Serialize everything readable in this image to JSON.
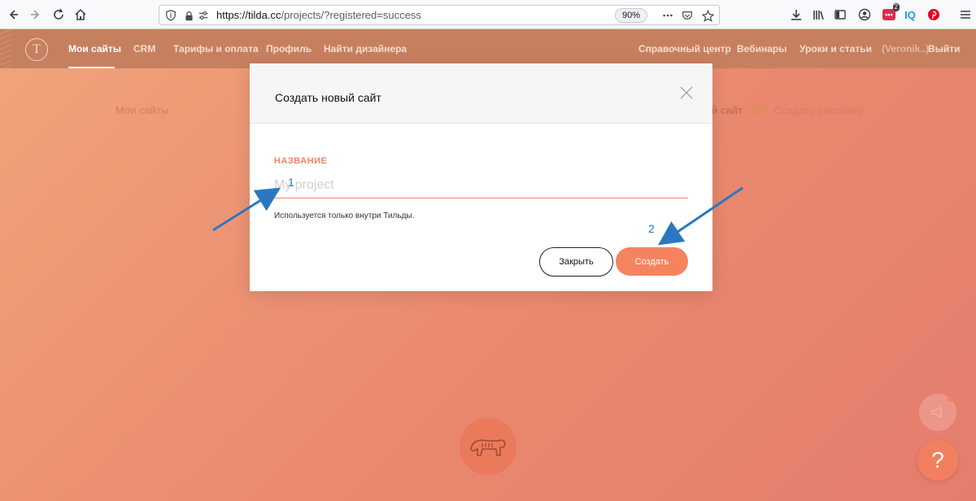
{
  "browser": {
    "url_host": "https://tilda.cc",
    "url_path": "/projects/?registered=success",
    "zoom": "90%",
    "extension_badge_count": "2",
    "extension_iq_label": "IQ"
  },
  "nav": {
    "items": [
      {
        "label": "Мои сайты"
      },
      {
        "label": "CRM"
      },
      {
        "label": "Тарифы и оплата"
      },
      {
        "label": "Профиль"
      },
      {
        "label": "Найти дизайнера"
      }
    ],
    "right_items": [
      {
        "label": "Справочный центр"
      },
      {
        "label": "Вебинары"
      },
      {
        "label": "Уроки и статьи"
      }
    ],
    "user_label": "(Veronik..)",
    "logout_label": "Выйти"
  },
  "subnav": {
    "my_sites": "Мои сайты",
    "create_site_fragment": "й сайт",
    "create_newsletter": "Создать рассылку"
  },
  "modal": {
    "title": "Создать новый сайт",
    "field_label": "НАЗВАНИЕ",
    "field_placeholder": "My project",
    "field_hint": "Используется только внутри Тильды.",
    "close_label": "Закрыть",
    "create_label": "Создать"
  },
  "help": {
    "label": "?"
  },
  "annotations": {
    "one": "1",
    "two": "2"
  },
  "colors": {
    "accent": "#f4845f",
    "nav_bg": "#c7805f",
    "arrow": "#2a78c2"
  }
}
